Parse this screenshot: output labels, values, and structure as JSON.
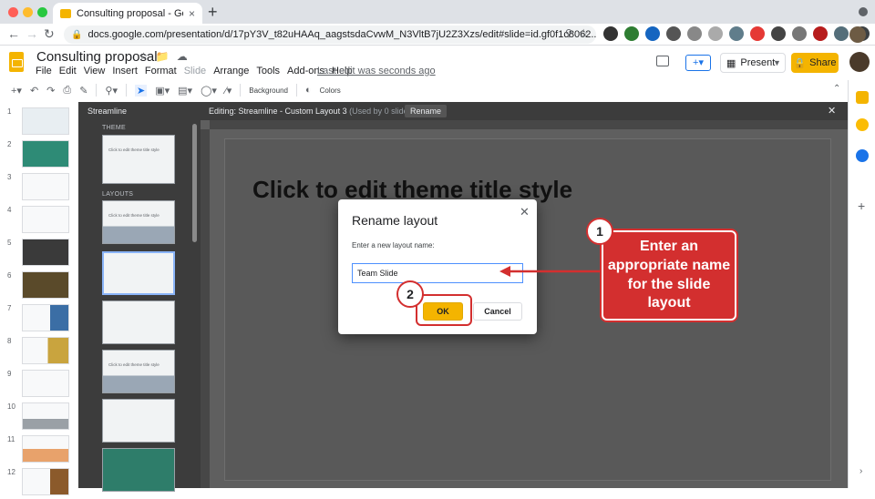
{
  "browser": {
    "tab_title": "Consulting proposal - Google S",
    "tab_close": "×",
    "new_tab": "+",
    "url": "docs.google.com/presentation/d/17pY3V_t82uHAAq_aagstsdaCvwM_N3VltB7jU2Z3Xzs/edit#slide=id.gf0f1c8062..."
  },
  "app": {
    "doc_title": "Consulting proposal",
    "menu": [
      "File",
      "Edit",
      "View",
      "Insert",
      "Format",
      "Slide",
      "Arrange",
      "Tools",
      "Add-ons",
      "Help"
    ],
    "last_edit": "Last edit was seconds ago",
    "present_label": "Present",
    "share_label": "Share"
  },
  "toolbar": {
    "background_label": "Background",
    "colors_label": "Colors"
  },
  "filmstrip": {
    "numbers": [
      "1",
      "2",
      "3",
      "4",
      "5",
      "6",
      "7",
      "8",
      "9",
      "10",
      "11",
      "12"
    ]
  },
  "theme_panel": {
    "theme_name": "Streamline",
    "theme_section": "THEME",
    "layouts_section": "LAYOUTS",
    "theme_thumb_text": "Click to edit theme title style",
    "layout_thumb_text": "Click to edit theme title style"
  },
  "editor": {
    "editing_label": "Editing: Streamline - Custom Layout 3",
    "used_by": "(Used by 0 slides)",
    "rename_chip": "Rename",
    "slide_title": "Click to edit theme title style"
  },
  "dialog": {
    "title": "Rename layout",
    "label": "Enter a new layout name:",
    "input_value": "Team Slide",
    "ok_label": "OK",
    "cancel_label": "Cancel"
  },
  "annotations": {
    "step1": "1",
    "step2": "2",
    "callout_text": "Enter an appropriate name for the slide layout",
    "accent_color": "#d32f2f"
  },
  "colors": {
    "brand_yellow": "#f4b400",
    "link_blue": "#1a73e8"
  }
}
